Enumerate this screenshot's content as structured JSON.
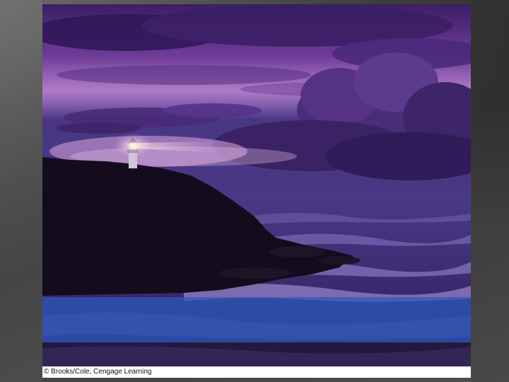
{
  "slide": {
    "background_color": "#4a4a4a",
    "band_color": "#285abe"
  },
  "photo": {
    "subject": "lighthouse-on-cliff-at-dusk",
    "palette": {
      "sky_top": "#3a1f66",
      "sky_mid": "#8a55b0",
      "sky_glow": "#c89ad8",
      "sea": "#3b2a6e",
      "cliff": "#140c1c",
      "light": "#fff6d8"
    }
  },
  "credit": {
    "text": "© Brooks/Cole, Cengage Learning"
  }
}
